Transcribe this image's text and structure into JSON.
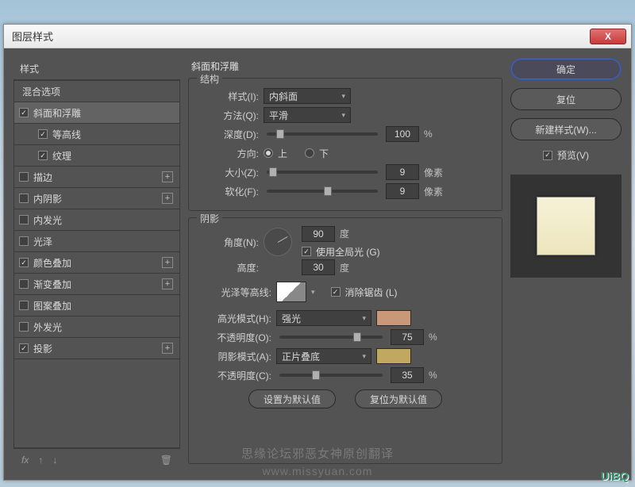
{
  "window": {
    "title": "图层样式",
    "close": "X"
  },
  "left": {
    "header": "样式",
    "blend": "混合选项",
    "items": [
      {
        "label": "斜面和浮雕",
        "checked": true,
        "plus": false,
        "selected": true,
        "indent": false
      },
      {
        "label": "等高线",
        "checked": true,
        "plus": false,
        "indent": true
      },
      {
        "label": "纹理",
        "checked": true,
        "plus": false,
        "indent": true
      },
      {
        "label": "描边",
        "checked": false,
        "plus": true
      },
      {
        "label": "内阴影",
        "checked": false,
        "plus": true
      },
      {
        "label": "内发光",
        "checked": false,
        "plus": false
      },
      {
        "label": "光泽",
        "checked": false,
        "plus": false
      },
      {
        "label": "颜色叠加",
        "checked": true,
        "plus": true
      },
      {
        "label": "渐变叠加",
        "checked": false,
        "plus": true
      },
      {
        "label": "图案叠加",
        "checked": false,
        "plus": false
      },
      {
        "label": "外发光",
        "checked": false,
        "plus": false
      },
      {
        "label": "投影",
        "checked": true,
        "plus": true
      }
    ],
    "fx_icon": "fx"
  },
  "middle": {
    "title": "斜面和浮雕",
    "structure": {
      "legend": "结构",
      "style_label": "样式(I):",
      "style_value": "内斜面",
      "tech_label": "方法(Q):",
      "tech_value": "平滑",
      "depth_label": "深度(D):",
      "depth_value": "100",
      "depth_unit": "%",
      "dir_label": "方向:",
      "dir_up": "上",
      "dir_down": "下",
      "size_label": "大小(Z):",
      "size_value": "9",
      "size_unit": "像素",
      "soften_label": "软化(F):",
      "soften_value": "9",
      "soften_unit": "像素"
    },
    "shading": {
      "legend": "阴影",
      "angle_label": "角度(N):",
      "angle_value": "90",
      "angle_unit": "度",
      "global_light": "使用全局光 (G)",
      "alt_label": "高度:",
      "alt_value": "30",
      "alt_unit": "度",
      "gloss_label": "光泽等高线:",
      "aa": "消除锯齿 (L)",
      "hl_mode_label": "高光模式(H):",
      "hl_mode_value": "强光",
      "hl_color": "#c89878",
      "hl_op_label": "不透明度(O):",
      "hl_op_value": "75",
      "hl_op_unit": "%",
      "sh_mode_label": "阴影模式(A):",
      "sh_mode_value": "正片叠底",
      "sh_color": "#c0a860",
      "sh_op_label": "不透明度(C):",
      "sh_op_value": "35",
      "sh_op_unit": "%"
    },
    "default_btn": "设置为默认值",
    "reset_btn": "复位为默认值"
  },
  "right": {
    "ok": "确定",
    "cancel": "复位",
    "new_style": "新建样式(W)...",
    "preview_label": "预览(V)"
  },
  "watermark": "思缘论坛邪恶女神原创翻译",
  "watermark2": "www.missyuan.com",
  "corner": "UiBQ"
}
